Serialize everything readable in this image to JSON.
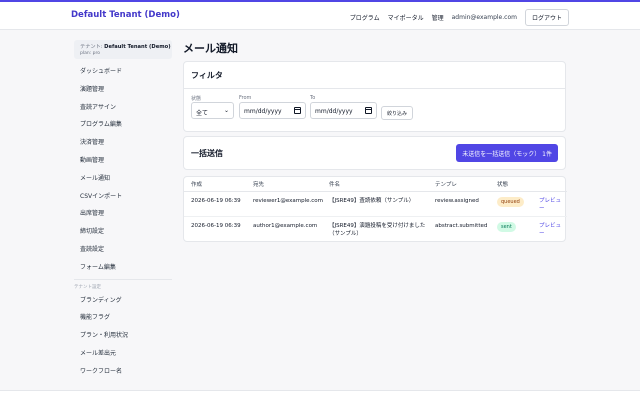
{
  "header": {
    "brand": "Default Tenant (Demo)",
    "nav": [
      "プログラム",
      "マイポータル",
      "管理"
    ],
    "email": "admin@example.com",
    "logout": "ログアウト"
  },
  "sidebar": {
    "tenant_label": "テナント:",
    "tenant_name": "Default Tenant (Demo)",
    "plan": "plan: pro",
    "items": [
      "ダッシュボード",
      "演題管理",
      "査読アサイン",
      "プログラム編集",
      "決済管理",
      "動画管理",
      "メール通知",
      "CSVインポート",
      "出席管理",
      "締切設定",
      "査読設定",
      "フォーム編集"
    ],
    "section_label": "テナント設定",
    "settings_items": [
      "ブランディング",
      "機能フラグ",
      "プラン・利用状況",
      "メール差出元",
      "ワークフロー名"
    ]
  },
  "main": {
    "title": "メール通知",
    "filter": {
      "title": "フィルタ",
      "status_label": "状態",
      "status_value": "全て",
      "from_label": "From",
      "from_placeholder": "mm/dd/yyyy",
      "to_label": "To",
      "to_placeholder": "mm/dd/yyyy",
      "apply": "絞り込み"
    },
    "bulk": {
      "title": "一括送信",
      "button": "未送信を一括送信（モック） 1件"
    },
    "table": {
      "columns": [
        "作成",
        "宛先",
        "件名",
        "テンプレ",
        "状態",
        ""
      ],
      "rows": [
        {
          "created": "2026-06-19 06:39",
          "to": "reviewer1@example.com",
          "subject": "【JSRE49】査読依頼（サンプル）",
          "template": "review.assigned",
          "status": "queued",
          "action": "プレビュー"
        },
        {
          "created": "2026-06-19 06:39",
          "to": "author1@example.com",
          "subject": "【JSRE49】演題投稿を受け付けました（サンプル）",
          "template": "abstract.submitted",
          "status": "sent",
          "action": "プレビュー"
        }
      ]
    }
  },
  "colors": {
    "accent": "#5046e5",
    "queued_bg": "#fdecc8",
    "sent_bg": "#d1fae5"
  }
}
